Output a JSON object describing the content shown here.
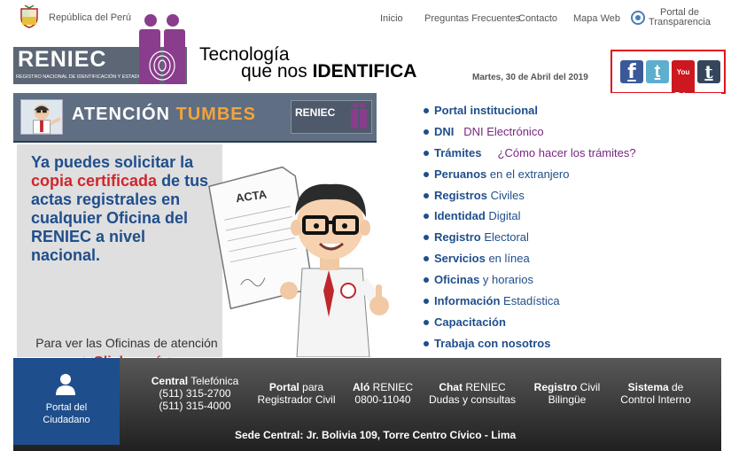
{
  "top": {
    "peru_label": "República del Perú",
    "nav": [
      "Inicio",
      "Preguntas Frecuentes",
      "Contacto",
      "Mapa Web"
    ],
    "transparency_label": "Portal de Transparencia"
  },
  "header": {
    "logo_text": "RENIEC",
    "logo_subtitle": "REGISTRO NACIONAL DE IDENTIFICACIÓN Y ESTADO CIVIL",
    "tagline_line1": "Tecnología",
    "tagline_line2_prefix": "que nos ",
    "tagline_line2_bold": "IDENTIFICA",
    "date": "Martes, 30 de Abril del 2019"
  },
  "social": {
    "facebook": "f",
    "twitter": "t",
    "youtube": "You Tube",
    "tumblr": "t"
  },
  "banner": {
    "attention_prefix": "ATENCIÓN ",
    "attention_city": "TUMBES",
    "mini_logo": "RENIEC",
    "promo_part1": "Ya puedes solicitar la ",
    "promo_red": "copia certificada",
    "promo_part2": " de tus actas registrales en cualquier Oficina del RENIEC a nivel nacional.",
    "acta_label": "ACTA",
    "promo_sub": "Para ver las Oficinas de atención",
    "promo_click": "<<Click aquí>>"
  },
  "menu": [
    {
      "bold": "Portal institucional",
      "rest": ""
    },
    {
      "bold": "DNI",
      "rest": "",
      "extra": "DNI Electrónico"
    },
    {
      "bold": "Trámites",
      "rest": "",
      "extra": "¿Cómo hacer los trámites?"
    },
    {
      "bold": "Peruanos",
      "rest": " en el extranjero"
    },
    {
      "bold": "Registros",
      "rest": " Civiles"
    },
    {
      "bold": "Identidad",
      "rest": " Digital"
    },
    {
      "bold": "Registro",
      "rest": " Electoral"
    },
    {
      "bold": "Servicios",
      "rest": " en línea"
    },
    {
      "bold": "Oficinas",
      "rest": " y horarios"
    },
    {
      "bold": "Información",
      "rest": " Estadística"
    },
    {
      "bold": "Capacitación",
      "rest": ""
    },
    {
      "bold": "Trabaja con nosotros",
      "rest": ""
    }
  ],
  "footer": {
    "portal_line1": "Portal del",
    "portal_line2": "Ciudadano",
    "central_bold": "Central",
    "central_rest": " Telefónica",
    "central_phone1": "(511) 315-2700",
    "central_phone2": "(511) 315-4000",
    "registrador_bold": "Portal",
    "registrador_rest": " para",
    "registrador_line2": "Registrador Civil",
    "alo_bold": "Aló",
    "alo_rest": " RENIEC",
    "alo_phone": "0800-11040",
    "chat_bold": "Chat",
    "chat_rest": " RENIEC",
    "chat_line2": "Dudas y consultas",
    "registro_bold": "Registro",
    "registro_rest": " Civil",
    "registro_line2": "Bilingüe",
    "sistema_bold": "Sistema",
    "sistema_rest": " de",
    "sistema_line2": "Control Interno",
    "sede_bold": "Sede Central:",
    "sede_rest": " Jr. Bolivia 109, Torre Centro Cívico - Lima"
  },
  "colors": {
    "brand_blue": "#1f4e8c",
    "accent_red": "#d0262c",
    "accent_purple": "#7a2680",
    "highlight_frame": "#e0141e"
  }
}
